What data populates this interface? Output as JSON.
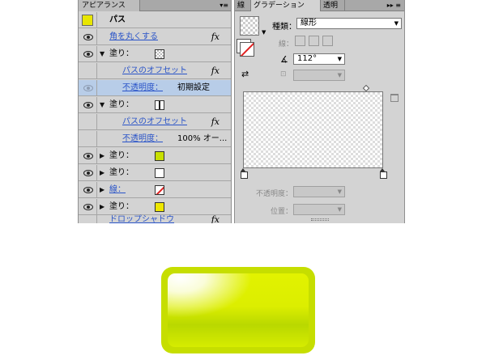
{
  "appearance": {
    "tab_label": "アピアランス",
    "menu_glyph": "▾≡",
    "header": "パス",
    "rows": [
      {
        "kind": "effect",
        "label": "角を丸くする",
        "fx": "fx"
      },
      {
        "kind": "fill",
        "label": "塗り：",
        "expanded": true,
        "swatch": "checker"
      },
      {
        "kind": "sub-effect",
        "label": "パスのオフセット",
        "fx": "fx"
      },
      {
        "kind": "opacity",
        "label": "不透明度：",
        "value": "初期設定"
      },
      {
        "kind": "fill",
        "label": "塗り：",
        "expanded": true,
        "swatch": "grad"
      },
      {
        "kind": "sub-effect",
        "label": "パスのオフセット",
        "fx": "fx"
      },
      {
        "kind": "opacity",
        "label": "不透明度：",
        "value": "100% オー..."
      },
      {
        "kind": "fill",
        "label": "塗り：",
        "expanded": false,
        "swatch": "lime"
      },
      {
        "kind": "fill",
        "label": "塗り：",
        "expanded": false,
        "swatch": "white"
      },
      {
        "kind": "stroke",
        "label": "線：",
        "expanded": false,
        "swatch": "none"
      },
      {
        "kind": "fill",
        "label": "塗り：",
        "expanded": false,
        "swatch": "yellow"
      },
      {
        "kind": "effect",
        "label": "ドロップシャドウ",
        "fx": "fx"
      }
    ]
  },
  "gradient": {
    "tabs": [
      "線",
      "グラデーション",
      "透明"
    ],
    "menu_glyph": "▸▸ ≡",
    "type_label": "種類：",
    "type_value": "線形",
    "stroke_label": "線：",
    "angle_value": "112°",
    "opacity_label": "不透明度：",
    "position_label": "位置："
  },
  "colors": {
    "panel_bg": "#d3d3d3",
    "highlight": "#b8cde8",
    "link": "#2a54c8",
    "button_lime": "#c6de00"
  }
}
